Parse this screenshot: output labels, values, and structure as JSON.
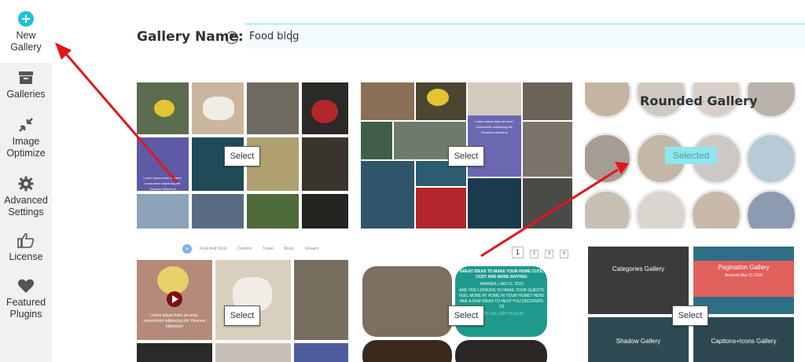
{
  "sidebar": {
    "items": [
      {
        "label": "New\nGallery",
        "icon": "plus-circle-icon"
      },
      {
        "label": "Galleries",
        "icon": "archive-box-icon"
      },
      {
        "label": "Image\nOptimize",
        "icon": "compress-arrows-icon"
      },
      {
        "label": "Advanced\nSettings",
        "icon": "gear-icon"
      },
      {
        "label": "License",
        "icon": "thumbs-up-icon"
      },
      {
        "label": "Featured\nPlugins",
        "icon": "heart-icon"
      }
    ]
  },
  "header": {
    "label": "Gallery Name:",
    "help": "?",
    "input_value": "Food blog"
  },
  "templates": {
    "select_label": "Select",
    "selected_label": "Selected",
    "rounded_title": "Rounded Gallery",
    "filters": [
      "All",
      "Food And Drink",
      "Comfort",
      "Travel",
      "Music",
      "Flowers"
    ],
    "pages": [
      "1",
      "2",
      "3",
      "4"
    ],
    "overlay_text_1": "Lorem ipsum dolor sit amet, consectetur adipiscing elit. Vivamus bibendum",
    "overlay_text_2": "Lorem ipsum dolor sit amet, consectetur adipiscing elit. Vivamus bibendum",
    "mosaic_text": "Lorem ipsum dolor sit amet, consectetur adipiscing elit. Vivamus bibendum",
    "teal_card_title": "GREAT IDEAS TO MAKE YOUR HOME CUTE, COZY AND MORE INVITING",
    "teal_card_sub": "AMANDA | JAN 12, 2015",
    "teal_card_body": "ARE YOU LOOKING TO MAKE YOUR GUESTS FEEL MORE AT HOME IN YOUR HOME? HERE ARE A FEW IDEAS TO HELP YOU DECORATE TO",
    "teal_card_footer": "FOO GALLERY PLUGIN",
    "card_categories": "Categories Gallery",
    "card_pagination": "Pagination Gallery",
    "card_pagination_sub": "Amanda   Mar 21 2015",
    "card_shadow": "Shadow Gallery",
    "card_captions": "Captions+Icons Gallery"
  },
  "colors": {
    "accent_teal": "#1ec3d7",
    "arrow_red": "#e0161b",
    "selected_bg": "#8ce8ee"
  }
}
